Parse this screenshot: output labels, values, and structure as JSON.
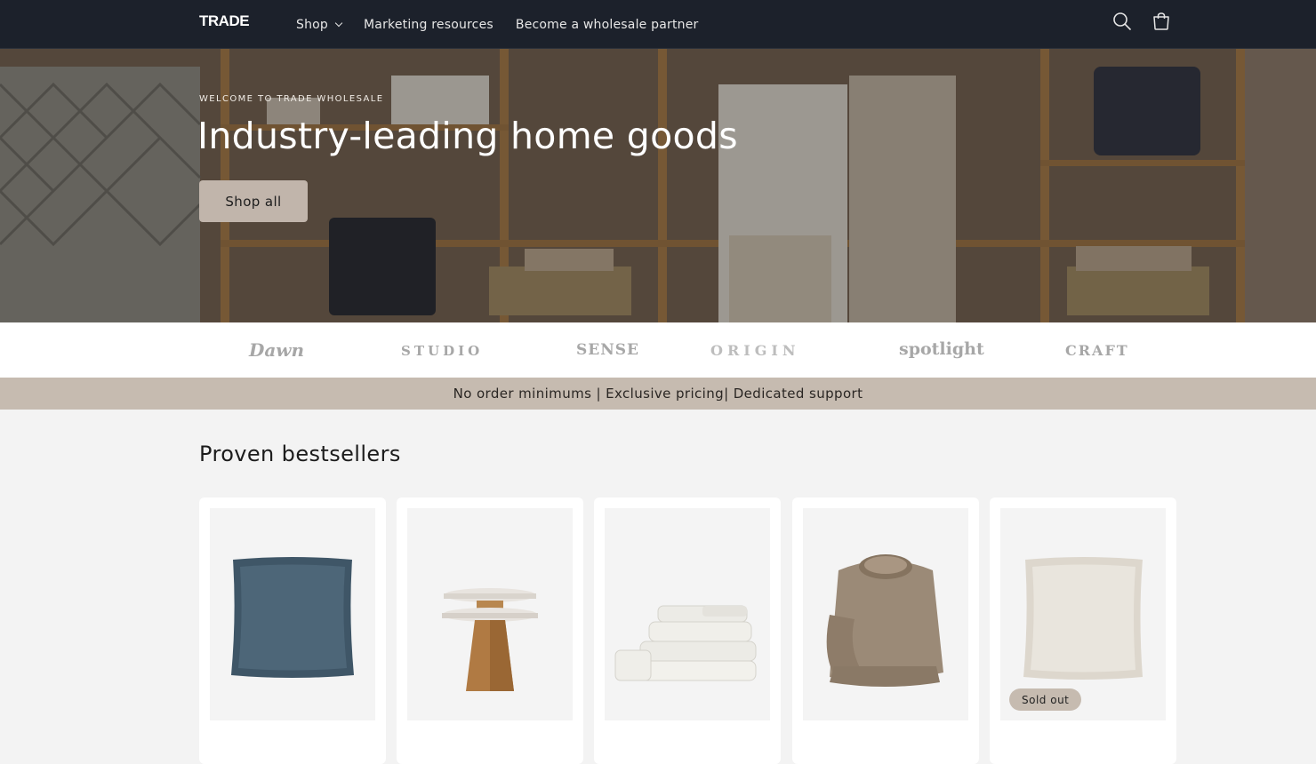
{
  "header": {
    "logo": "TRADE",
    "nav": [
      {
        "label": "Shop",
        "has_dropdown": true
      },
      {
        "label": "Marketing resources",
        "has_dropdown": false
      },
      {
        "label": "Become a wholesale partner",
        "has_dropdown": false
      }
    ],
    "icons": [
      "search-icon",
      "cart-icon"
    ]
  },
  "hero": {
    "kicker": "WELCOME TO TRADE WHOLESALE",
    "title": "Industry-leading home goods",
    "button": "Shop all"
  },
  "brands": [
    "Dawn",
    "STUDIO",
    "SENSE",
    "ORIGIN",
    "spotlight",
    "CRAFT"
  ],
  "announcement": "No order minimums | Exclusive pricing| Dedicated support",
  "bestsellers": {
    "title": "Proven bestsellers",
    "products": [
      {
        "image": "blue-pillow"
      },
      {
        "image": "marble-wood-side-table"
      },
      {
        "image": "white-towel-stack"
      },
      {
        "image": "taupe-sweatshirt"
      },
      {
        "image": "cream-pillow",
        "badge": "Sold out"
      }
    ]
  },
  "colors": {
    "header_bg": "#1c212b",
    "accent": "#c6bbb0",
    "page_bg": "#f3f3f3"
  }
}
